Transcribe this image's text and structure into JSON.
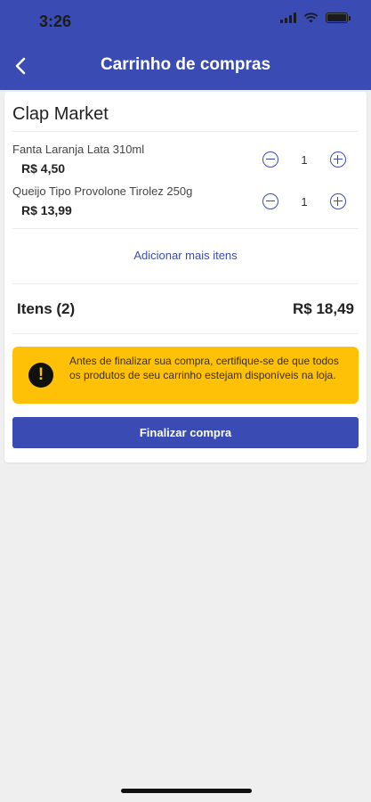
{
  "status_bar": {
    "time": "3:26"
  },
  "header": {
    "title": "Carrinho de compras",
    "back_icon": "chevron-left-icon",
    "background": "#3a4cb3"
  },
  "cart": {
    "store_name": "Clap Market",
    "items": [
      {
        "name": "Fanta Laranja Lata 310ml",
        "price": "R$ 4,50",
        "quantity": "1"
      },
      {
        "name": "Queijo Tipo Provolone Tirolez 250g",
        "price": "R$ 13,99",
        "quantity": "1"
      }
    ],
    "add_more_label": "Adicionar mais itens",
    "total_label": "Itens (2)",
    "total_value": "R$ 18,49"
  },
  "warning": {
    "text": "Antes de finalizar sua compra, certifique-se de que todos os produtos de seu carrinho estejam disponíveis na loja.",
    "icon": "exclamation-icon",
    "color": "#ffc107"
  },
  "finish_button_label": "Finalizar compra"
}
